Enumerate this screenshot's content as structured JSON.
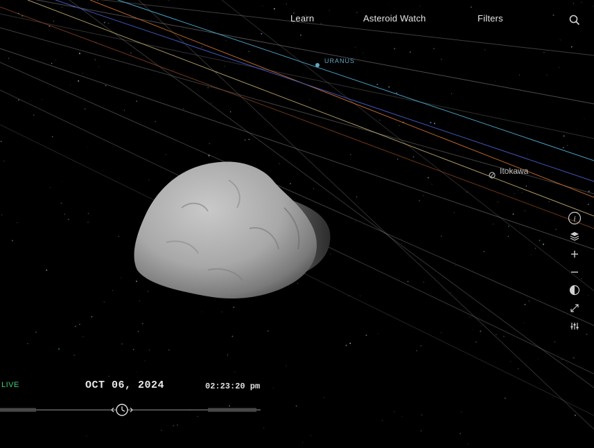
{
  "nav": {
    "learn": "Learn",
    "asteroid_watch": "Asteroid Watch",
    "filters": "Filters"
  },
  "icons": {
    "search": "search-icon",
    "info": "info-icon",
    "layers": "layers-icon",
    "zoom_in": "plus-icon",
    "zoom_out": "minus-icon",
    "contrast": "contrast-icon",
    "fullscreen": "expand-icon",
    "settings": "sliders-icon",
    "time_scrubber": "clock-icon"
  },
  "labels": {
    "uranus": "URANUS",
    "itokawa": "Itokawa"
  },
  "time": {
    "live": "LIVE",
    "date": "OCT 06, 2024",
    "clock": "02:23:20 pm"
  },
  "colors": {
    "background": "#000000",
    "live": "#3ecf7a",
    "planet_label": "#5fa8c2",
    "orbit_cyan": "#4fb3d9",
    "orbit_orange": "#d2702e",
    "orbit_blue": "#4a5fd0",
    "orbit_yellow": "#d9c27a",
    "orbit_gray": "#8a8a8a"
  }
}
